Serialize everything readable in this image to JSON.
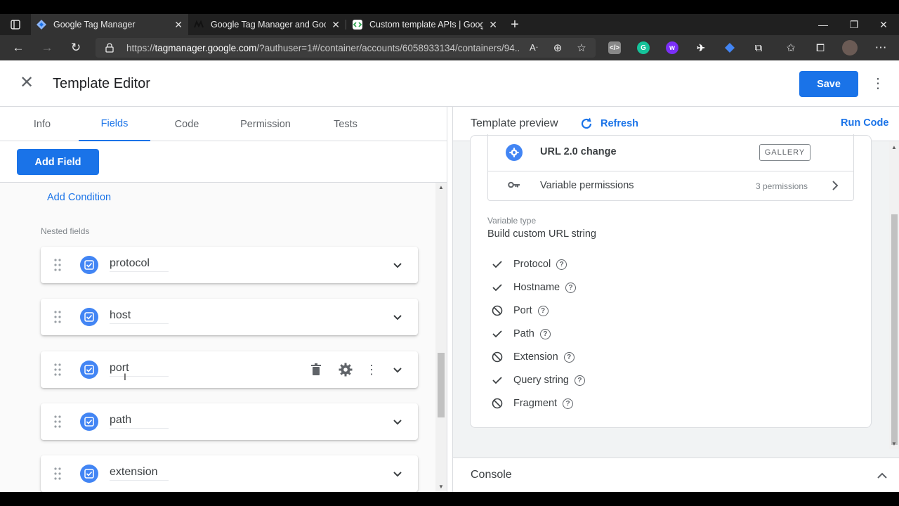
{
  "browser": {
    "tabs": [
      {
        "title": "Google Tag Manager",
        "active": true
      },
      {
        "title": "Google Tag Manager and Google",
        "active": false
      },
      {
        "title": "Custom template APIs  |  Google",
        "active": false
      }
    ],
    "new_tab": "+",
    "url_prefix": "https://",
    "url_host": "tagmanager.google.com",
    "url_rest": "/?authuser=1#/container/accounts/6058933134/containers/94..."
  },
  "header": {
    "title": "Template Editor",
    "save_label": "Save"
  },
  "editor_tabs": [
    "Info",
    "Fields",
    "Code",
    "Permission",
    "Tests"
  ],
  "active_editor_tab": "Fields",
  "fields_panel": {
    "add_field_label": "Add Field",
    "add_condition_label": "Add Condition",
    "nested_fields_label": "Nested fields",
    "fields": [
      {
        "name": "protocol"
      },
      {
        "name": "host"
      },
      {
        "name": "port",
        "hovered": true
      },
      {
        "name": "path"
      },
      {
        "name": "extension"
      }
    ]
  },
  "preview": {
    "title": "Template preview",
    "refresh_label": "Refresh",
    "run_code_label": "Run Code",
    "template_name": "URL 2.0 change",
    "gallery_badge": "GALLERY",
    "permissions_label": "Variable permissions",
    "permissions_count": "3 permissions",
    "variable_type_label": "Variable type",
    "variable_type_value": "Build custom URL string",
    "options": [
      {
        "label": "Protocol",
        "state": "checked"
      },
      {
        "label": "Hostname",
        "state": "checked"
      },
      {
        "label": "Port",
        "state": "disabled"
      },
      {
        "label": "Path",
        "state": "checked"
      },
      {
        "label": "Extension",
        "state": "disabled"
      },
      {
        "label": "Query string",
        "state": "checked"
      },
      {
        "label": "Fragment",
        "state": "disabled"
      }
    ]
  },
  "console": {
    "title": "Console"
  },
  "colors": {
    "accent": "#1a73e8",
    "checkbox": "#4285f4"
  }
}
